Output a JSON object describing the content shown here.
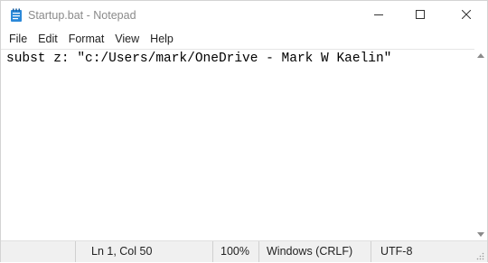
{
  "window": {
    "title": "Startup.bat - Notepad"
  },
  "menu": {
    "items": [
      "File",
      "Edit",
      "Format",
      "View",
      "Help"
    ]
  },
  "editor": {
    "content": "subst z: \"c:/Users/mark/OneDrive - Mark W Kaelin\""
  },
  "status": {
    "position": "Ln 1, Col 50",
    "zoom": "100%",
    "line_ending": "Windows (CRLF)",
    "encoding": "UTF-8"
  },
  "icons": {
    "app": "notepad-icon",
    "minimize": "minimize-icon",
    "maximize": "maximize-icon",
    "close": "close-icon"
  },
  "colors": {
    "app_icon": "#2b88d8",
    "title_text": "#8a8a8a",
    "status_bar": "#f0f0f0"
  }
}
